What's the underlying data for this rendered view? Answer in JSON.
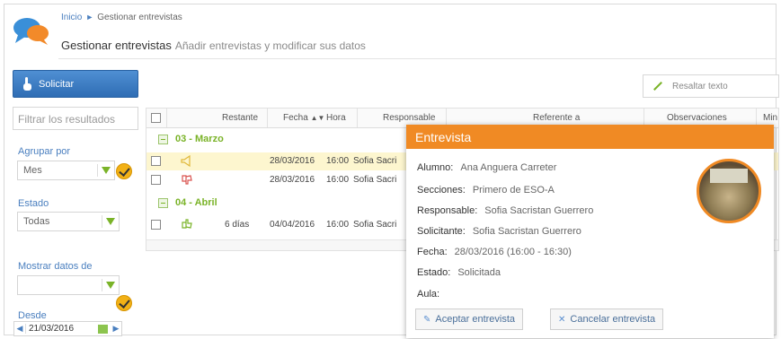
{
  "header": {
    "breadcrumb_home": "Inicio",
    "breadcrumb_current": "Gestionar entrevistas",
    "title": "Gestionar entrevistas",
    "subtitle": "Añadir entrevistas y modificar sus datos"
  },
  "sidebar": {
    "solicitar_label": "Solicitar",
    "filter_placeholder": "Filtrar los resultados",
    "agrupar_label": "Agrupar por",
    "agrupar_value": "Mes",
    "estado_label": "Estado",
    "estado_value": "Todas",
    "mostrar_label": "Mostrar datos de",
    "mostrar_value": "",
    "desde_label": "Desde",
    "desde_value": "21/03/2016"
  },
  "toolbar": {
    "resaltar_label": "Resaltar texto"
  },
  "table": {
    "columns": [
      "Restante",
      "Fecha",
      "Hora",
      "Responsable",
      "Referente a",
      "Observaciones",
      "Min"
    ],
    "groups": [
      {
        "label": "03 - Marzo"
      },
      {
        "label": "04 - Abril"
      }
    ],
    "rows": [
      {
        "restante": "",
        "fecha": "28/03/2016",
        "hora": "16:00",
        "responsable": "Sofia Sacri"
      },
      {
        "restante": "",
        "fecha": "28/03/2016",
        "hora": "16:00",
        "responsable": "Sofia Sacri"
      },
      {
        "restante": "6 días",
        "fecha": "04/04/2016",
        "hora": "16:00",
        "responsable": "Sofia Sacri"
      }
    ]
  },
  "popup": {
    "title": "Entrevista",
    "fields": [
      {
        "label": "Alumno:",
        "value": "Ana Anguera Carreter"
      },
      {
        "label": "Secciones:",
        "value": "Primero de ESO-A"
      },
      {
        "label": "Responsable:",
        "value": "Sofia Sacristan Guerrero"
      },
      {
        "label": "Solicitante:",
        "value": "Sofia Sacristan Guerrero"
      },
      {
        "label": "Fecha:",
        "value": "28/03/2016 (16:00 - 16:30)"
      },
      {
        "label": "Estado:",
        "value": "Solicitada"
      },
      {
        "label": "Aula:",
        "value": ""
      }
    ],
    "accept_label": "Aceptar entrevista",
    "cancel_label": "Cancelar entrevista"
  },
  "colors": {
    "accent_blue": "#3a78c2",
    "accent_orange": "#f08a24",
    "accent_green": "#7ab328"
  }
}
